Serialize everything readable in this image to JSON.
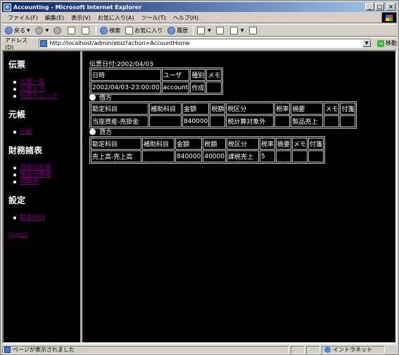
{
  "window": {
    "title": "Accounting - Microsoft Internet Explorer",
    "controls": {
      "minimize": "_",
      "maximize": "□",
      "close": "×"
    }
  },
  "menu": [
    "ファイル(F)",
    "編集(E)",
    "表示(V)",
    "お気に入り(A)",
    "ツール(T)",
    "ヘルプ(H)"
  ],
  "toolbar": {
    "back": "戻る",
    "search": "検索",
    "favorites": "お気に入り",
    "history": "履歴"
  },
  "address": {
    "label": "アドレス(D)",
    "url": "http://localhost/admin/ebiz?action=AccountHome",
    "go": "移動"
  },
  "sidebar": {
    "sections": [
      {
        "title": "伝票",
        "links": [
          "伝票一覧",
          "伝票入力",
          "伝票チェック"
        ]
      },
      {
        "title": "元帳",
        "links": [
          "元帳"
        ]
      },
      {
        "title": "財務諸表",
        "links": [
          "貸借対照表",
          "損益計算書",
          "試算表"
        ]
      },
      {
        "title": "設定",
        "links": [
          "勘定科目"
        ]
      }
    ],
    "logout": "Logout"
  },
  "voucher": {
    "date_label": "伝票日付:2002/04/03",
    "header_table": {
      "columns": [
        "日時",
        "ユーザ",
        "種別",
        "メモ"
      ],
      "row": [
        "2002/04/03-23:00:00",
        "account",
        "作成",
        ""
      ]
    },
    "debit": {
      "label": "借方",
      "columns": [
        "勘定科目",
        "補助科目",
        "金額",
        "税額",
        "税区分",
        "税率",
        "摘要",
        "メモ",
        "付箋"
      ],
      "row": [
        "当座資産-売掛金",
        "",
        "840000",
        "",
        "税計算対象外",
        "",
        "製品売上",
        "",
        ""
      ]
    },
    "credit": {
      "label": "貸方",
      "columns": [
        "勘定科目",
        "補助科目",
        "金額",
        "税額",
        "税区分",
        "税率",
        "摘要",
        "メモ",
        "付箋"
      ],
      "row": [
        "売上高-売上高",
        "",
        "840000",
        "40000",
        "課税売上",
        "5",
        "",
        "",
        ""
      ]
    }
  },
  "status": {
    "message": "ページが表示されました",
    "zone": "イントラネット"
  }
}
